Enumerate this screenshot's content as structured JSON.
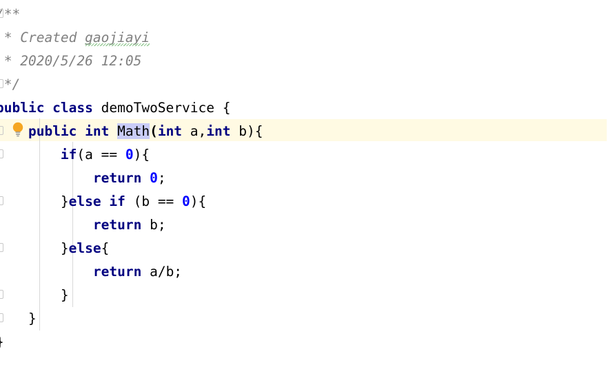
{
  "editor": {
    "language": "java",
    "file_kind": "java-class-source",
    "background_color": "#ffffff",
    "caret_row_color": "#fffae3",
    "keyword_color": "#000080",
    "comment_color": "#808080",
    "number_color": "#0000ff",
    "selected_identifier_color": "#c9ccf7",
    "indent_guide_color": "#d8d8d8",
    "spellcheck_underline_color": "#7fbf7f",
    "fold_marker_color": "#c8c8c8"
  },
  "gutter": {
    "intention_bulb": {
      "icon": "lightbulb-icon",
      "color": "#f5a623",
      "tooltip": "Show intention actions"
    },
    "fold_markers": [
      {
        "row": 0
      },
      {
        "row": 3
      },
      {
        "row": 5
      },
      {
        "row": 6
      },
      {
        "row": 8
      },
      {
        "row": 10
      },
      {
        "row": 12
      },
      {
        "row": 13
      }
    ]
  },
  "code": {
    "lines": [
      {
        "n": 1,
        "type": "comment",
        "text": "/**",
        "tokens": [
          {
            "t": "/**",
            "k": "cmt"
          }
        ]
      },
      {
        "n": 2,
        "type": "comment",
        "text": " * Created gaojiayi",
        "tokens": [
          {
            "t": " * Created ",
            "k": "cmt"
          },
          {
            "t": "gaojiayi",
            "k": "cmt-spell"
          }
        ]
      },
      {
        "n": 3,
        "type": "comment",
        "text": " * 2020/5/26 12:05",
        "tokens": [
          {
            "t": " * 2020/5/26 12:05",
            "k": "cmt"
          }
        ]
      },
      {
        "n": 4,
        "type": "comment",
        "text": " */",
        "tokens": [
          {
            "t": " */",
            "k": "cmt"
          }
        ]
      },
      {
        "n": 5,
        "type": "code",
        "text": "public class demoTwoService {",
        "tokens": [
          {
            "t": "public class ",
            "k": "kw"
          },
          {
            "t": "demoTwoService {",
            "k": "plain"
          }
        ]
      },
      {
        "n": 6,
        "type": "code",
        "caret": true,
        "text": "    public int Math(int a,int b){",
        "tokens": [
          {
            "t": "    ",
            "k": "ind"
          },
          {
            "t": "public int ",
            "k": "kw"
          },
          {
            "t": "Math",
            "k": "sel-ident"
          },
          {
            "t": "(",
            "k": "punc"
          },
          {
            "t": "int",
            "k": "kw"
          },
          {
            "t": " a,",
            "k": "plain"
          },
          {
            "t": "int",
            "k": "kw"
          },
          {
            "t": " b){",
            "k": "plain"
          }
        ]
      },
      {
        "n": 7,
        "type": "code",
        "text": "        if(a == 0){",
        "tokens": [
          {
            "t": "        ",
            "k": "ind"
          },
          {
            "t": "if",
            "k": "kw"
          },
          {
            "t": "(a == ",
            "k": "plain"
          },
          {
            "t": "0",
            "k": "num"
          },
          {
            "t": "){",
            "k": "plain"
          }
        ]
      },
      {
        "n": 8,
        "type": "code",
        "text": "            return 0;",
        "tokens": [
          {
            "t": "            ",
            "k": "ind"
          },
          {
            "t": "return",
            "k": "kw"
          },
          {
            "t": " ",
            "k": "plain"
          },
          {
            "t": "0",
            "k": "num"
          },
          {
            "t": ";",
            "k": "plain"
          }
        ]
      },
      {
        "n": 9,
        "type": "code",
        "text": "        }else if (b == 0){",
        "tokens": [
          {
            "t": "        ",
            "k": "ind"
          },
          {
            "t": "}",
            "k": "plain"
          },
          {
            "t": "else if",
            "k": "kw"
          },
          {
            "t": " (b == ",
            "k": "plain"
          },
          {
            "t": "0",
            "k": "num"
          },
          {
            "t": "){",
            "k": "plain"
          }
        ]
      },
      {
        "n": 10,
        "type": "code",
        "text": "            return b;",
        "tokens": [
          {
            "t": "            ",
            "k": "ind"
          },
          {
            "t": "return",
            "k": "kw"
          },
          {
            "t": " b;",
            "k": "plain"
          }
        ]
      },
      {
        "n": 11,
        "type": "code",
        "text": "        }else{",
        "tokens": [
          {
            "t": "        ",
            "k": "ind"
          },
          {
            "t": "}",
            "k": "plain"
          },
          {
            "t": "else",
            "k": "kw"
          },
          {
            "t": "{",
            "k": "plain"
          }
        ]
      },
      {
        "n": 12,
        "type": "code",
        "text": "            return a/b;",
        "tokens": [
          {
            "t": "            ",
            "k": "ind"
          },
          {
            "t": "return",
            "k": "kw"
          },
          {
            "t": " a/b;",
            "k": "plain"
          }
        ]
      },
      {
        "n": 13,
        "type": "code",
        "text": "        }",
        "tokens": [
          {
            "t": "        ",
            "k": "ind"
          },
          {
            "t": "}",
            "k": "plain"
          }
        ]
      },
      {
        "n": 14,
        "type": "code",
        "text": "    }",
        "tokens": [
          {
            "t": "    ",
            "k": "ind"
          },
          {
            "t": "}",
            "k": "plain"
          }
        ]
      },
      {
        "n": 15,
        "type": "code",
        "text": "}",
        "tokens": [
          {
            "t": "}",
            "k": "plain"
          }
        ]
      }
    ]
  }
}
